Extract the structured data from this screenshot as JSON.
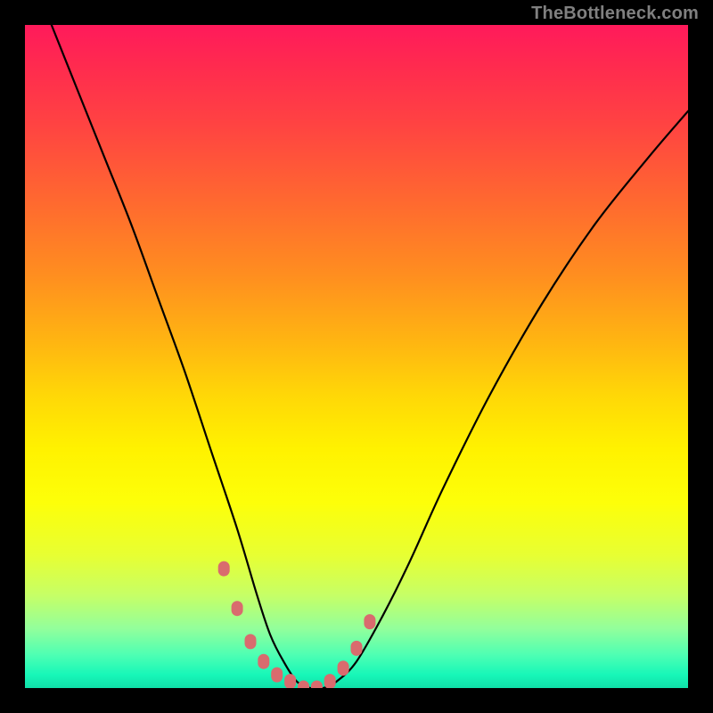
{
  "watermark": "TheBottleneck.com",
  "chart_data": {
    "type": "line",
    "title": "",
    "xlabel": "",
    "ylabel": "",
    "xlim": [
      0,
      100
    ],
    "ylim": [
      0,
      100
    ],
    "grid": false,
    "legend": false,
    "background_gradient": {
      "direction": "vertical",
      "stops": [
        {
          "pos": 0.0,
          "color": "#ff1a5b"
        },
        {
          "pos": 0.5,
          "color": "#ffd807"
        },
        {
          "pos": 0.8,
          "color": "#e7ff33"
        },
        {
          "pos": 1.0,
          "color": "#10e0a9"
        }
      ]
    },
    "series": [
      {
        "name": "bottleneck-curve",
        "x": [
          4,
          8,
          12,
          16,
          20,
          24,
          28,
          32,
          35,
          37,
          39,
          41,
          43,
          45,
          47,
          50,
          54,
          58,
          63,
          70,
          78,
          86,
          94,
          100
        ],
        "y": [
          100,
          90,
          80,
          70,
          59,
          48,
          36,
          24,
          14,
          8,
          4,
          1,
          0,
          0,
          1,
          4,
          11,
          19,
          30,
          44,
          58,
          70,
          80,
          87
        ]
      }
    ],
    "markers": {
      "name": "highlight-points",
      "color": "#d96b6e",
      "x": [
        30,
        32,
        34,
        36,
        38,
        40,
        42,
        44,
        46,
        48,
        50,
        52
      ],
      "y": [
        18,
        12,
        7,
        4,
        2,
        1,
        0,
        0,
        1,
        3,
        6,
        10
      ]
    }
  }
}
